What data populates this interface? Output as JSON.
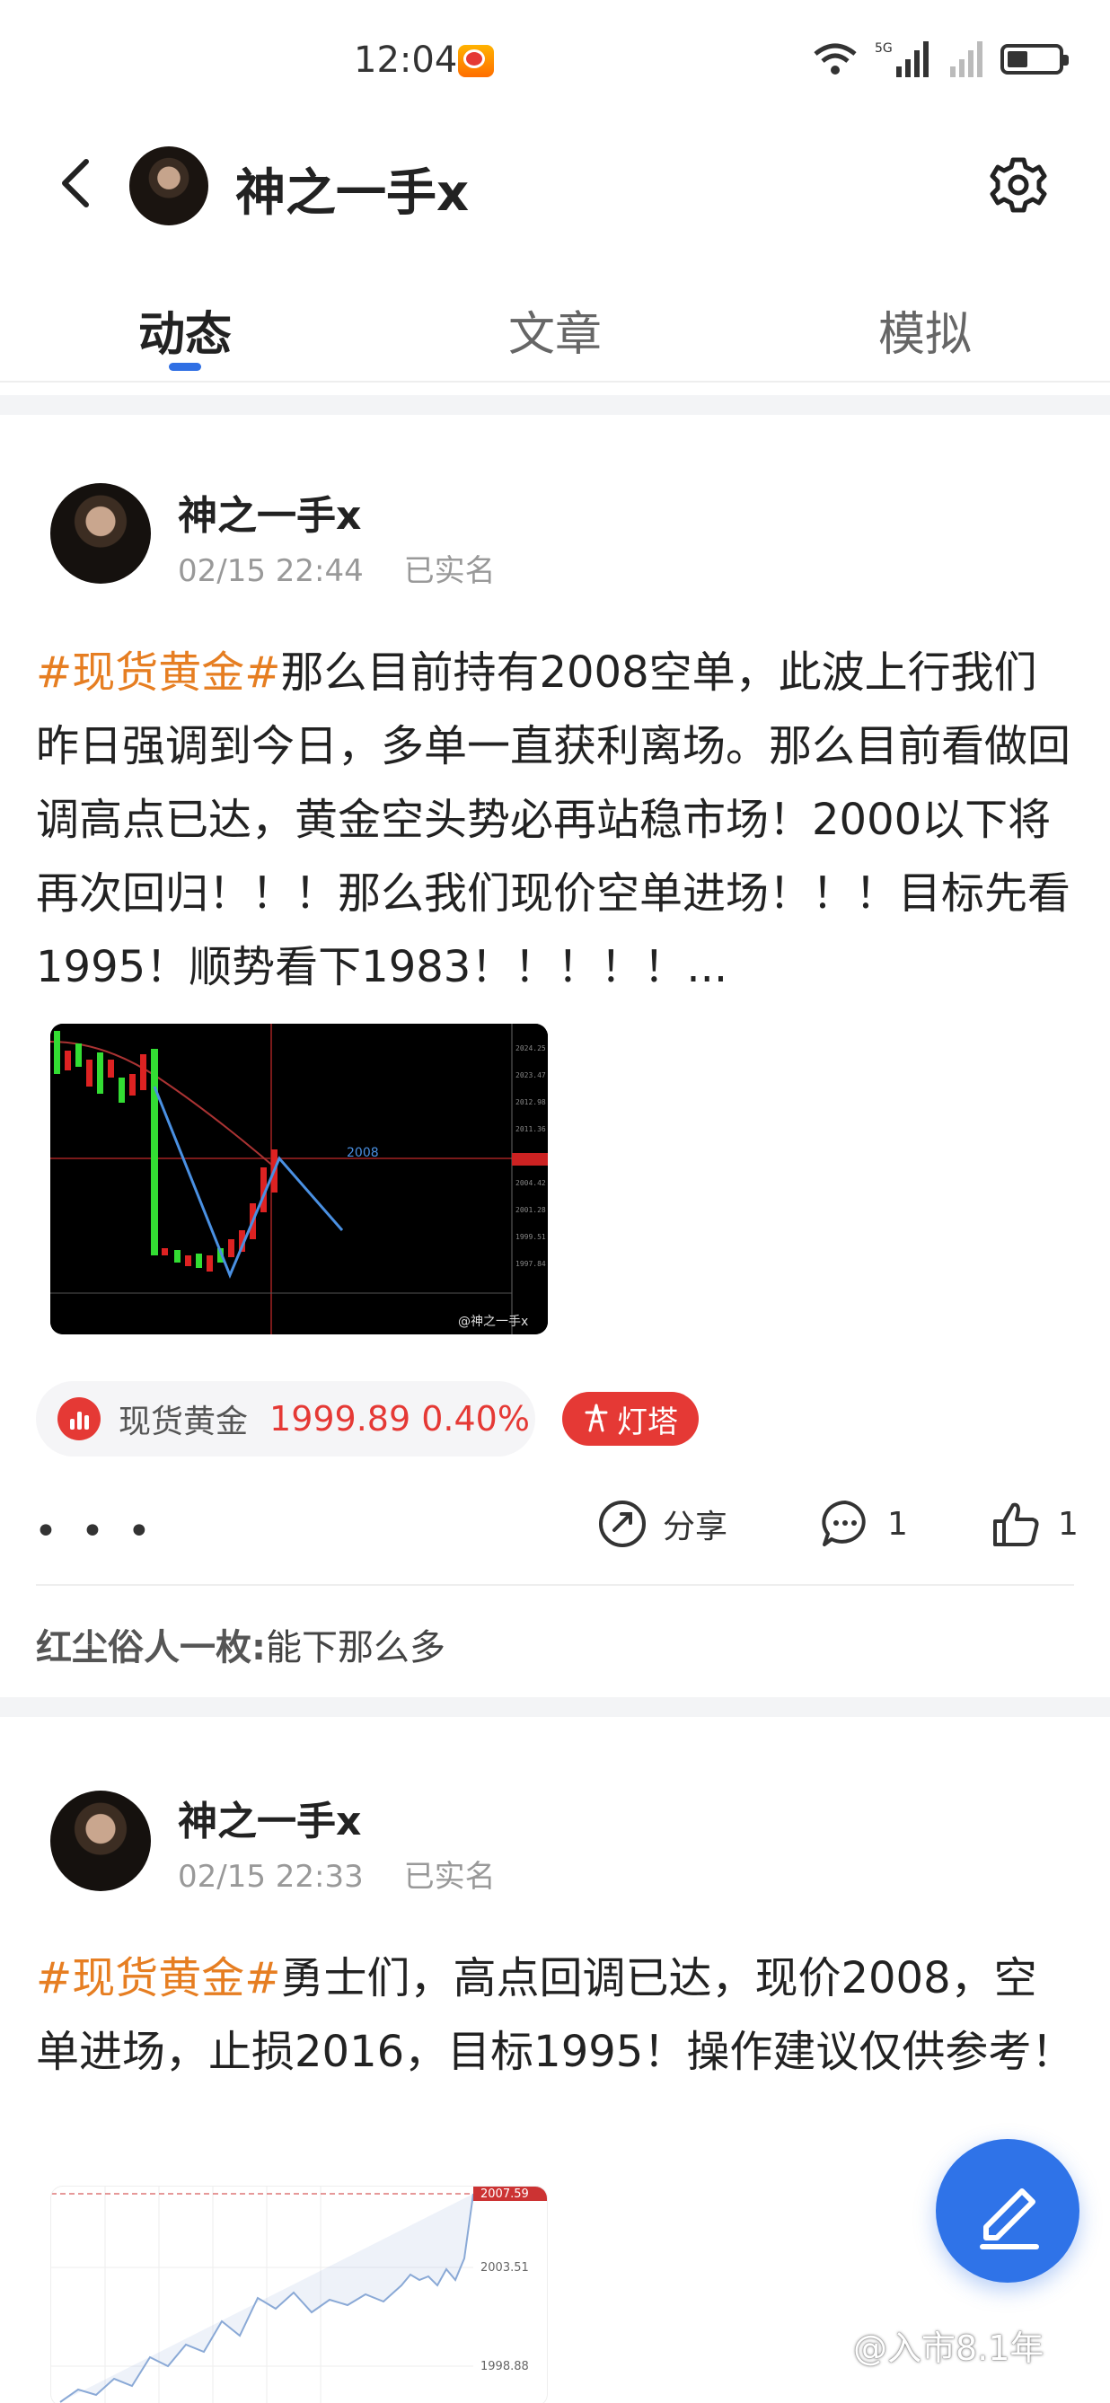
{
  "status_bar": {
    "time": "12:04",
    "network": "5G"
  },
  "header": {
    "title": "神之一手x"
  },
  "tabs": [
    {
      "label": "动态",
      "active": true
    },
    {
      "label": "文章",
      "active": false
    },
    {
      "label": "模拟",
      "active": false
    }
  ],
  "posts": [
    {
      "author": "神之一手x",
      "datetime": "02/15 22:44",
      "verified": "已实名",
      "hashtag": "#现货黄金#",
      "text": "那么目前持有2008空单，此波上行我们昨日强调到今日，多单一直获利离场。那么目前看做回调高点已达，黄金空头势必再站稳市场！2000以下将再次回归！！！那么我们现价空单进场！！！目标先看1995！顺势看下1983！！！！！...",
      "chart_label": "2008",
      "chart_watermark": "@神之一手x",
      "quote": {
        "name": "现货黄金",
        "price": "1999.89 0.40%"
      },
      "badge": "灯塔",
      "share_label": "分享",
      "comment_count": "1",
      "like_count": "1",
      "top_comment": {
        "user": "红尘俗人一枚:",
        "text": "能下那么多"
      }
    },
    {
      "author": "神之一手x",
      "datetime": "02/15 22:33",
      "verified": "已实名",
      "hashtag": "#现货黄金#",
      "text": "勇士们，高点回调已达，现价2008，空单进场，止损2016，目标1995！操作建议仅供参考！",
      "chart_top": "2007.59",
      "chart_mid": "2003.51",
      "chart_low": "1998.88"
    }
  ],
  "colors": {
    "accent": "#2f6fe4",
    "hashtag": "#e67e22",
    "price_up": "#e53935"
  },
  "watermark": "@入市8.1年"
}
